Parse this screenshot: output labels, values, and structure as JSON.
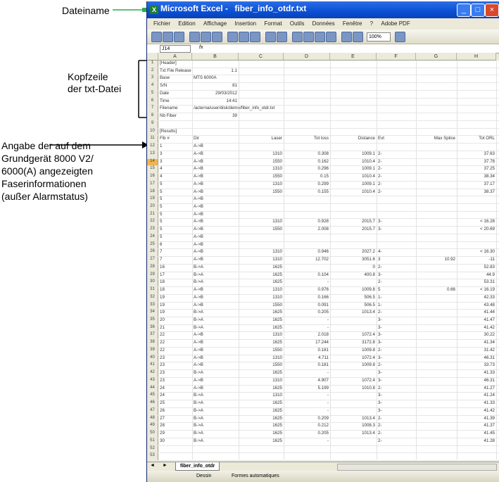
{
  "annotations": {
    "filename_label": "Dateiname",
    "header_label": [
      "Kopfzeile",
      "der txt-Datei"
    ],
    "results_label": [
      "Angabe der auf dem",
      "Grundgerät 8000 V2/",
      "6000(A) angezeigten",
      "Faserinformationen",
      "(außer Alarmstatus)"
    ]
  },
  "window": {
    "title_app": "Microsoft Excel -",
    "title_file": "fiber_info_otdr.txt",
    "menu": [
      "Fichier",
      "Edition",
      "Affichage",
      "Insertion",
      "Format",
      "Outils",
      "Données",
      "Fenêtre",
      "?",
      "Adobe PDF"
    ],
    "zoom": "100%",
    "namebox": "J14",
    "fx": "fx",
    "sheet_tab": "fiber_info_otdr",
    "draw_menu": "Dessin",
    "autoshapes": "Formes automatiques"
  },
  "columns": [
    "A",
    "B",
    "C",
    "D",
    "E",
    "F",
    "G",
    "H"
  ],
  "rows": [
    [
      "1",
      "[Header]",
      "",
      "",
      "",
      "",
      "",
      "",
      ""
    ],
    [
      "2",
      "Txt File Release",
      "1.1",
      "",
      "",
      "",
      "",
      "",
      ""
    ],
    [
      "3",
      "Base",
      "MTS 6000A",
      "",
      "",
      "",
      "",
      "",
      ""
    ],
    [
      "4",
      "S/N",
      "81",
      "",
      "",
      "",
      "",
      "",
      ""
    ],
    [
      "5",
      "Date",
      "29/03/2012",
      "",
      "",
      "",
      "",
      "",
      ""
    ],
    [
      "6",
      "Time",
      "14:41",
      "",
      "",
      "",
      "",
      "",
      ""
    ],
    [
      "7",
      "Filename",
      "/acterna/user/disk/demo/fiber_info_otdr.txt",
      "",
      "",
      "",
      "",
      "",
      ""
    ],
    [
      "8",
      "Nb Fiber",
      "39",
      "",
      "",
      "",
      "",
      "",
      ""
    ],
    [
      "9",
      "",
      "",
      "",
      "",
      "",
      "",
      "",
      ""
    ],
    [
      "10",
      "[Results]",
      "",
      "",
      "",
      "",
      "",
      "",
      ""
    ],
    [
      "11",
      "Fib #",
      "Dir",
      "Laser",
      "Tot loss",
      "Distance",
      "Evt",
      "Max Splice",
      "Tot ORL"
    ],
    [
      "12",
      "1",
      "A->B",
      "",
      "",
      "",
      "",
      "",
      ""
    ],
    [
      "13",
      "3",
      "A->B",
      "1310",
      "0.308",
      "1009.1",
      "2-",
      "",
      "37.63"
    ],
    [
      "14",
      "3",
      "A->B",
      "1550",
      "0.162",
      "1010.4",
      "2-",
      "",
      "37.78"
    ],
    [
      "15",
      "4",
      "A->B",
      "1310",
      "0.296",
      "1009.1",
      "2-",
      "",
      "37.25"
    ],
    [
      "16",
      "4",
      "A->B",
      "1550",
      "0.15",
      "1010.4",
      "2-",
      "",
      "38.34"
    ],
    [
      "17",
      "5",
      "A->B",
      "1310",
      "0.299",
      "1009.1",
      "2-",
      "",
      "37.17"
    ],
    [
      "18",
      "5",
      "A->B",
      "1550",
      "0.155",
      "1010.4",
      "2-",
      "",
      "38.37"
    ],
    [
      "19",
      "5",
      "A->B",
      "",
      "",
      "",
      "",
      "",
      ""
    ],
    [
      "20",
      "5",
      "A->B",
      "",
      "",
      "",
      "",
      "",
      ""
    ],
    [
      "21",
      "5",
      "A->B",
      "",
      "",
      "",
      "",
      "",
      ""
    ],
    [
      "22",
      "5",
      "A->B",
      "1310",
      "0.928",
      "2015.7",
      "3-",
      "",
      "< 16.28"
    ],
    [
      "23",
      "5",
      "A->B",
      "1550",
      "2.008",
      "2015.7",
      "3-",
      "",
      "< 20.69"
    ],
    [
      "24",
      "5",
      "A->B",
      "",
      "",
      "",
      "",
      "",
      ""
    ],
    [
      "25",
      "6",
      "A->B",
      "",
      "",
      "",
      "",
      "",
      ""
    ],
    [
      "26",
      "7",
      "A->B",
      "1310",
      "0.946",
      "2027.2",
      "4-",
      "",
      "< 16.30"
    ],
    [
      "27",
      "7",
      "A->B",
      "1310",
      "12.702",
      "3051.6",
      "3",
      "10.92",
      "-11"
    ],
    [
      "28",
      "16",
      "B->A",
      "1625",
      "",
      "0",
      "2-",
      "",
      "52.83"
    ],
    [
      "29",
      "17",
      "B->A",
      "1625",
      "0.104",
      "400.8",
      "3-",
      "",
      "44.9"
    ],
    [
      "30",
      "18",
      "B->A",
      "1625",
      "-",
      "",
      "2-",
      "",
      "53.31"
    ],
    [
      "31",
      "18",
      "A->B",
      "1310",
      "0.976",
      "1009.8",
      "5",
      "0.66",
      "< 16.19"
    ],
    [
      "32",
      "19",
      "A->B",
      "1310",
      "0.166",
      "506.5",
      "1-",
      "",
      "42.33"
    ],
    [
      "33",
      "19",
      "A->B",
      "1550",
      "0.091",
      "506.5",
      "1-",
      "",
      "43.48"
    ],
    [
      "34",
      "19",
      "B->A",
      "1625",
      "0.205",
      "1013.4",
      "2-",
      "",
      "41.44"
    ],
    [
      "35",
      "20",
      "B->A",
      "1625",
      "-",
      "",
      "3-",
      "",
      "41.47"
    ],
    [
      "36",
      "21",
      "B->A",
      "1625",
      "-",
      "",
      "3-",
      "",
      "41.42"
    ],
    [
      "37",
      "22",
      "A->B",
      "1310",
      "2.018",
      "1072.4",
      "3-",
      "",
      "30.22"
    ],
    [
      "38",
      "22",
      "A->B",
      "1625",
      "17.244",
      "3172.8",
      "3-",
      "",
      "41.34"
    ],
    [
      "39",
      "22",
      "A->B",
      "1550",
      "0.181",
      "1009.8",
      "2-",
      "",
      "31.42"
    ],
    [
      "40",
      "23",
      "A->B",
      "1310",
      "4.711",
      "1072.4",
      "3-",
      "",
      "46.31"
    ],
    [
      "41",
      "23",
      "A->B",
      "1550",
      "0.181",
      "1009.8",
      "2-",
      "",
      "33.73"
    ],
    [
      "42",
      "23",
      "B->A",
      "1625",
      "-",
      "",
      "3-",
      "",
      "41.33"
    ],
    [
      "43",
      "23",
      "A->B",
      "1310",
      "4.907",
      "1072.4",
      "3-",
      "",
      "46.31"
    ],
    [
      "44",
      "24",
      "A->B",
      "1625",
      "5.199",
      "1010.8",
      "2-",
      "",
      "41.27"
    ],
    [
      "45",
      "24",
      "B->A",
      "1310",
      "-",
      "",
      "3-",
      "",
      "41.24"
    ],
    [
      "46",
      "25",
      "B->A",
      "1625",
      "-",
      "",
      "3-",
      "",
      "41.33"
    ],
    [
      "47",
      "26",
      "B->A",
      "1625",
      "-",
      "",
      "3-",
      "",
      "41.42"
    ],
    [
      "48",
      "27",
      "B->A",
      "1625",
      "0.209",
      "1013.4",
      "2-",
      "",
      "41.39"
    ],
    [
      "49",
      "28",
      "B->A",
      "1625",
      "0.212",
      "1008.3",
      "2-",
      "",
      "41.37"
    ],
    [
      "50",
      "29",
      "B->A",
      "1625",
      "0.205",
      "1013.4",
      "2-",
      "",
      "41.45"
    ],
    [
      "51",
      "30",
      "B->A",
      "1625",
      "-",
      "",
      "2-",
      "",
      "41.28"
    ],
    [
      "52",
      "",
      "",
      "",
      "",
      "",
      "",
      "",
      ""
    ],
    [
      "53",
      "",
      "",
      "",
      "",
      "",
      "",
      "",
      ""
    ]
  ],
  "selected_row": "14",
  "colors": {
    "annotation_green": "#22b14c",
    "selection": "#f0b54c"
  }
}
